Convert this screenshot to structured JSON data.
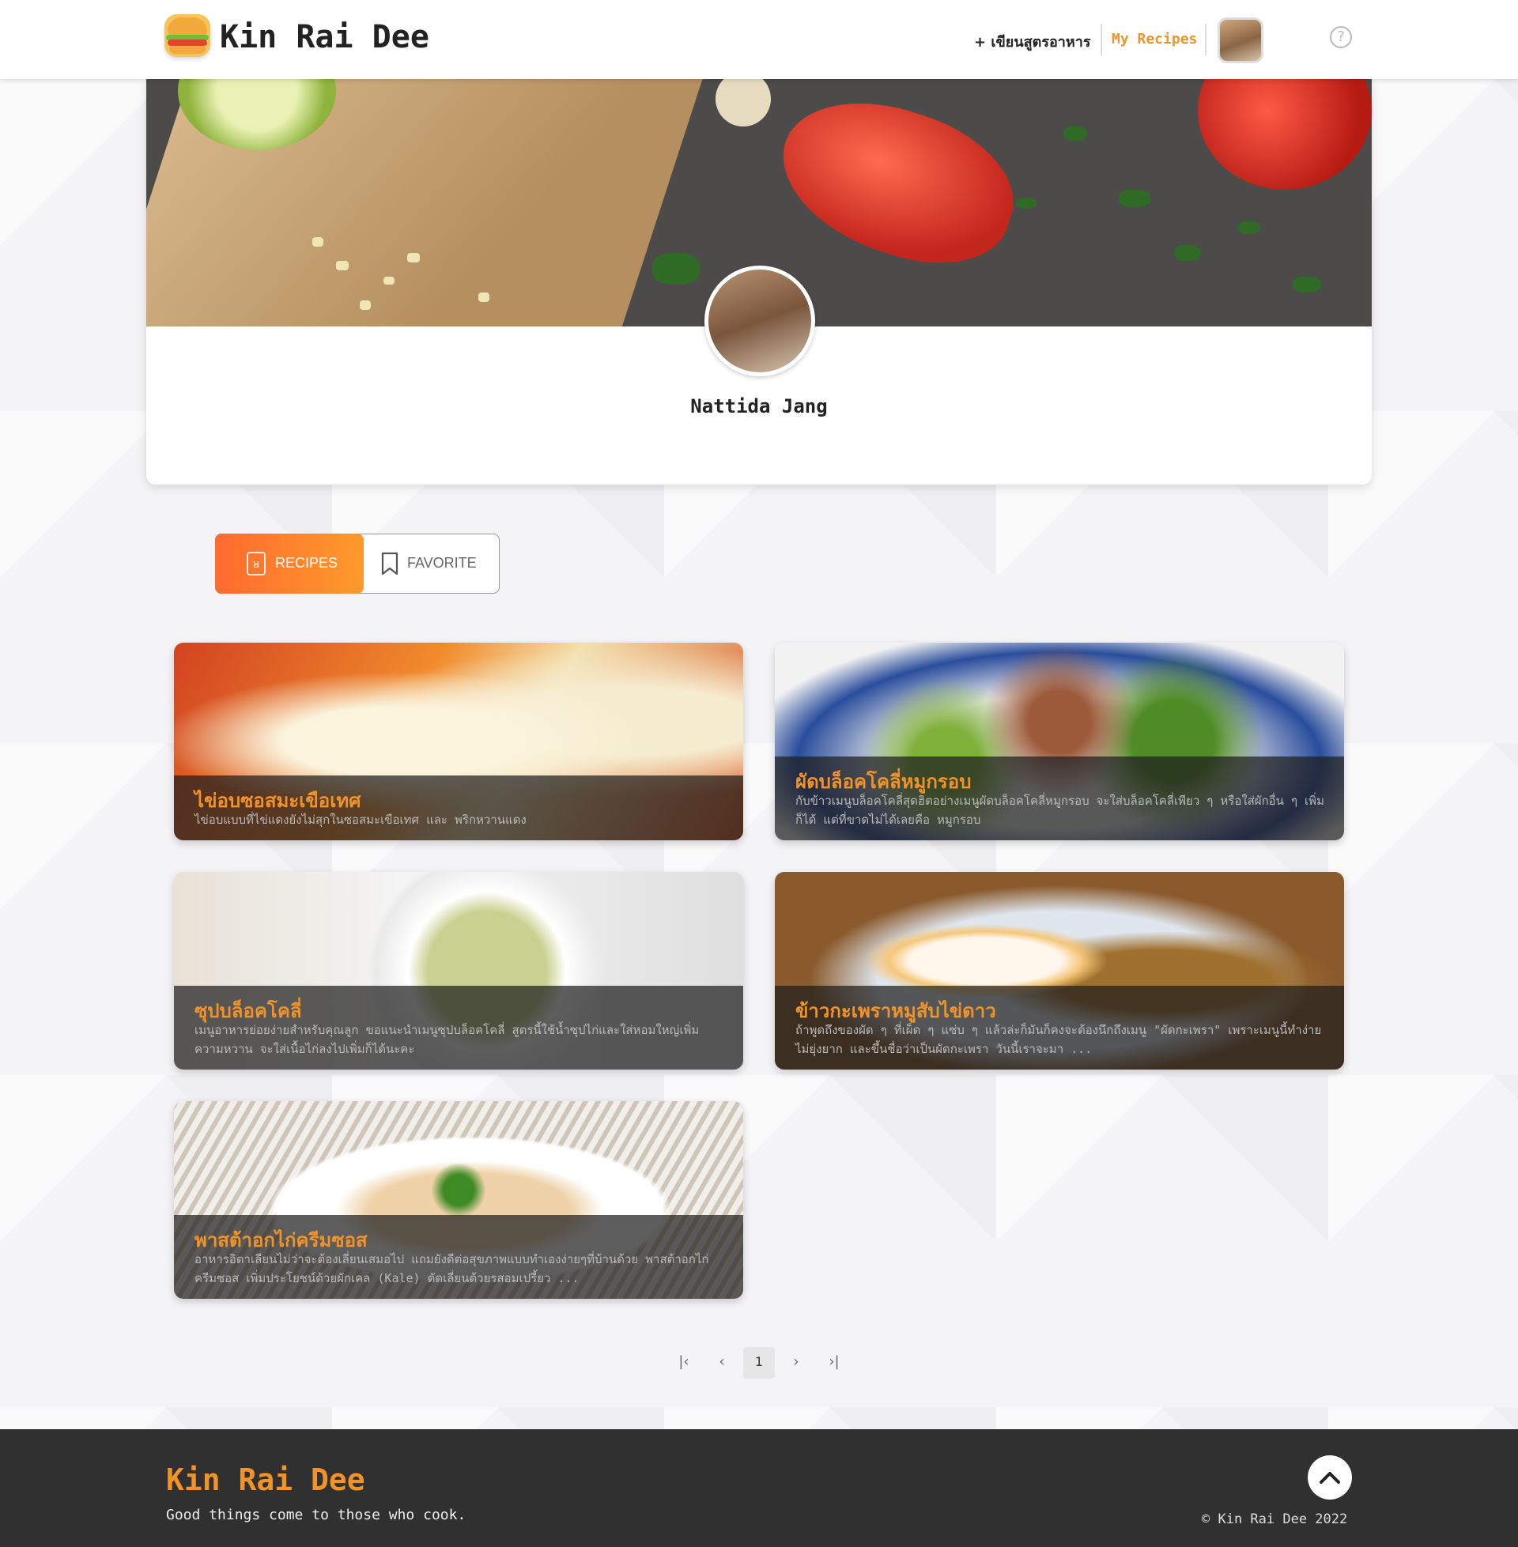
{
  "header": {
    "brand": "Kin Rai Dee",
    "write_recipe": "+ เขียนสูตรอาหาร",
    "my_recipes": "My Recipes",
    "help": "?"
  },
  "profile": {
    "name": "Nattida Jang"
  },
  "tabs": {
    "recipes": "RECIPES",
    "favorite": "FAVORITE"
  },
  "recipes": [
    {
      "title": "ไข่อบซอสมะเขือเทศ",
      "desc": "ไข่อบแบบที่ไข่แดงยังไม่สุกในซอสมะเขือเทศ และ พริกหวานแดง"
    },
    {
      "title": "ผัดบล็อคโคลี่หมูกรอบ",
      "desc": "กับข้าวเมนูบล็อคโคลี่สุดฮิตอย่างเมนูผัดบล็อคโคลี่หมูกรอบ จะใส่บล็อคโคลี่เพียว ๆ หรือใส่ผักอื่น ๆ เพิ่มก็ได้ แต่ที่ขาดไม่ได้เลยคือ หมูกรอบ"
    },
    {
      "title": "ซุปบล็อคโคลี่",
      "desc": "เมนูอาหารย่อยง่ายสำหรับคุณลูก ขอแนะนำเมนูซุปบล็อคโคลี่ สูตรนี้ใช้น้ำซุปไก่และใส่หอมใหญ่เพิ่มความหวาน จะใส่เนื้อไก่ลงไปเพิ่มก็ได้นะคะ"
    },
    {
      "title": "ข้าวกะเพราหมูสับไข่ดาว",
      "desc": "ถ้าพูดถึงของผัด ๆ ที่เผ็ด ๆ แซ่บ ๆ แล้วล่ะก็มันก็คงจะต้องนึกถึงเมนู \"ผัดกะเพรา\" เพราะเมนูนี้ทำง่ายไม่ยุ่งยาก และขึ้นชื่อว่าเป็นผัดกะเพรา วันนี้เราจะมา ..."
    },
    {
      "title": "พาสต้าอกไก่ครีมซอส",
      "desc": "อาหารอิตาเลียนไม่ว่าจะต้องเลี่ยนเสมอไป แถมยังดีต่อสุขภาพแบบทำเองง่ายๆที่บ้านด้วย พาสต้าอกไก่ครีมซอส เพิ่มประโยชน์ด้วยผักเคล (Kale) ตัดเลี่ยนด้วยรสอมเปรี้ยว ..."
    }
  ],
  "pagination": {
    "first": "|‹",
    "prev": "‹",
    "current": "1",
    "next": "›",
    "last": "›|"
  },
  "footer": {
    "brand": "Kin Rai Dee",
    "tagline": "Good things come to those who cook.",
    "copyright": "© Kin Rai Dee 2022"
  },
  "colors": {
    "accent": "#f0932b",
    "tab_gradient_start": "#ff6a2f",
    "tab_gradient_end": "#ff9a2b",
    "footer_bg": "#303030"
  }
}
